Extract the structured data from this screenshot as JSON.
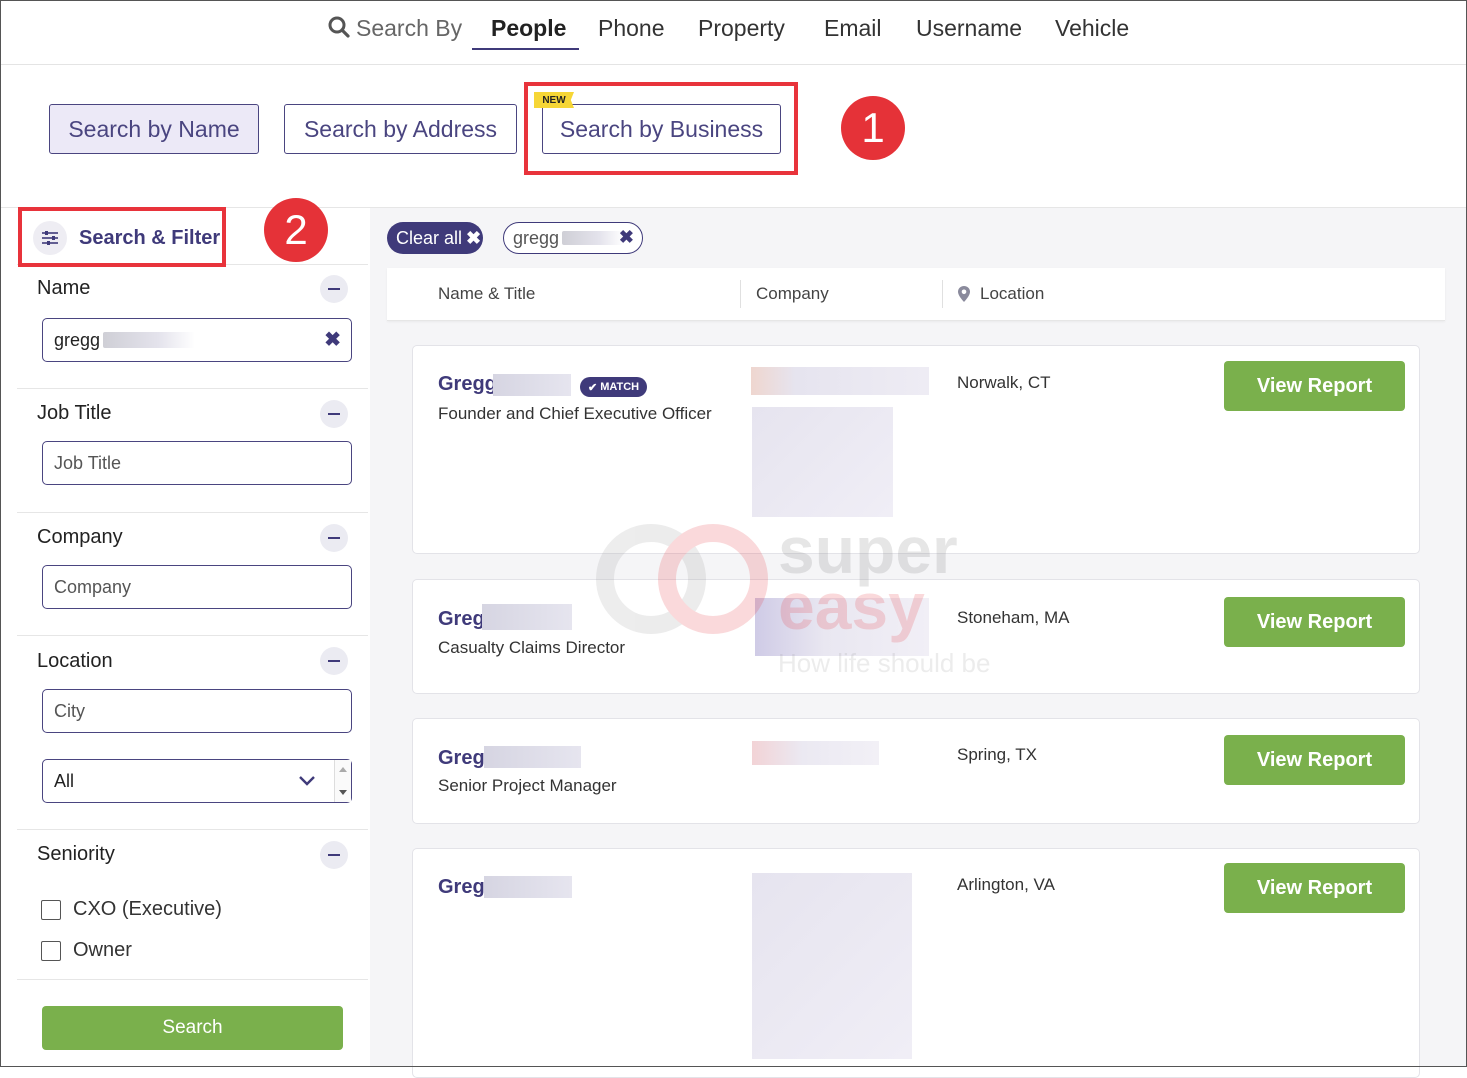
{
  "topnav": {
    "search_by": "Search By",
    "items": [
      "People",
      "Phone",
      "Property",
      "Email",
      "Username",
      "Vehicle"
    ]
  },
  "tabs": {
    "by_name": "Search by Name",
    "by_address": "Search by Address",
    "by_business": "Search by Business",
    "new_badge": "NEW"
  },
  "annotations": {
    "one": "1",
    "two": "2"
  },
  "sidebar": {
    "title": "Search & Filter",
    "name_label": "Name",
    "name_value": "gregg",
    "job_title_label": "Job Title",
    "job_title_placeholder": "Job Title",
    "company_label": "Company",
    "company_placeholder": "Company",
    "location_label": "Location",
    "city_placeholder": "City",
    "state_value": "All",
    "seniority_label": "Seniority",
    "seniority_options": [
      "CXO (Executive)",
      "Owner"
    ],
    "search_button": "Search"
  },
  "filters": {
    "clear_all": "Clear all",
    "chip": "gregg"
  },
  "table": {
    "col_name": "Name & Title",
    "col_company": "Company",
    "col_location": "Location"
  },
  "results": [
    {
      "name": "Gregg",
      "title": "Founder and Chief Executive Officer",
      "location": "Norwalk, CT",
      "badge": "MATCH",
      "button": "View Report"
    },
    {
      "name": "Greg",
      "title": "Casualty Claims Director",
      "location": "Stoneham, MA",
      "button": "View Report"
    },
    {
      "name": "Greg",
      "title": "Senior Project Manager",
      "location": "Spring, TX",
      "button": "View Report"
    },
    {
      "name": "Greg",
      "title": "",
      "location": "Arlington, VA",
      "button": "View Report"
    }
  ],
  "watermark": {
    "line1": "super",
    "line2": "easy",
    "tagline": "How life should be"
  },
  "colors": {
    "brand": "#3f3a7a",
    "action": "#7ab04c",
    "highlight": "#e8333b",
    "badge": "#f6d636"
  }
}
